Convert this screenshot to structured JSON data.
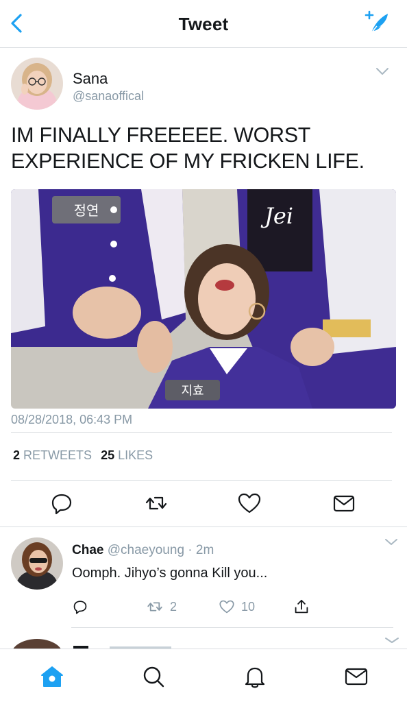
{
  "header": {
    "title": "Tweet",
    "back_icon": "chevron-left-icon",
    "compose_icon": "compose-tweet-icon",
    "accent": "#1da1f2"
  },
  "tweet": {
    "author_name": "Sana",
    "author_handle": "@sanaoffical",
    "text": "IM FINALLY FREEEEE. WORST EXPERIENCE OF MY FRICKEN LIFE.",
    "timestamp": "08/28/2018, 06:43 PM",
    "retweets_count": "2",
    "retweets_label": "RETWEETS",
    "likes_count": "25",
    "likes_label": "LIKES",
    "media_label_left": "정연",
    "media_label_center": "지효"
  },
  "reply": {
    "name": "Chae",
    "handle": "@chaeyoung",
    "separator": "·",
    "time": "2m",
    "text": "Oomph. Jihyo’s gonna Kill you...",
    "retweet_count": "2",
    "like_count": "10"
  },
  "tabs": [
    "home-icon",
    "search-icon",
    "notifications-icon",
    "messages-icon"
  ],
  "colors": {
    "accent": "#1da1f2",
    "secondary_text": "#8899a6",
    "primary_text": "#14171a",
    "divider": "#d9dde1",
    "icon_dark": "#14171a"
  }
}
